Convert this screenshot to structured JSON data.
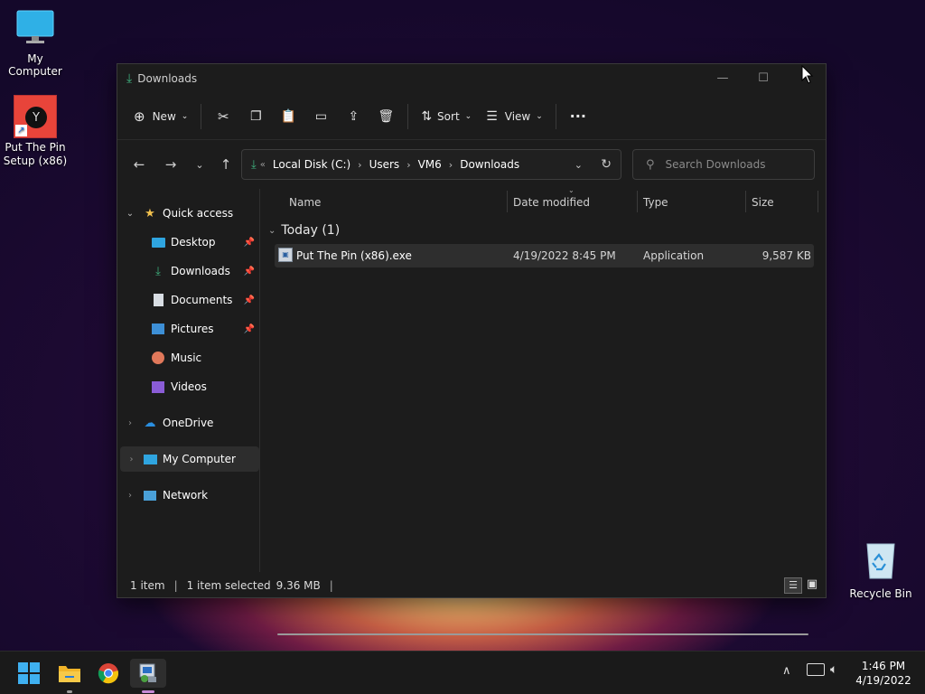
{
  "desktop": {
    "icons": [
      {
        "label": "My Computer"
      },
      {
        "label": "Put The Pin Setup (x86)"
      },
      {
        "label": "Recycle Bin"
      }
    ]
  },
  "window": {
    "title": "Downloads",
    "toolbar": {
      "new_label": "New",
      "sort_label": "Sort",
      "view_label": "View",
      "more_label": "···"
    },
    "address": {
      "overflow": "«",
      "crumbs": [
        "Local Disk (C:)",
        "Users",
        "VM6",
        "Downloads"
      ]
    },
    "search": {
      "placeholder": "Search Downloads"
    },
    "nav": {
      "quick_access": "Quick access",
      "items": [
        "Desktop",
        "Downloads",
        "Documents",
        "Pictures",
        "Music",
        "Videos"
      ],
      "onedrive": "OneDrive",
      "my_computer": "My Computer",
      "network": "Network"
    },
    "columns": [
      "Name",
      "Date modified",
      "Type",
      "Size"
    ],
    "group": "Today (1)",
    "files": [
      {
        "name": "Put The Pin (x86).exe",
        "date": "4/19/2022 8:45 PM",
        "type": "Application",
        "size": "9,587 KB"
      }
    ],
    "status": {
      "count": "1 item",
      "selected": "1 item selected",
      "size": "9.36 MB"
    }
  },
  "taskbar": {
    "time": "1:46 PM",
    "date": "4/19/2022"
  },
  "colors": {
    "accent": "#0078d4",
    "green_arrow": "#3fb27f",
    "star": "#f2c14e"
  }
}
